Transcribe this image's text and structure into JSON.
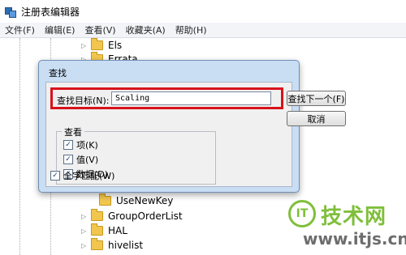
{
  "window": {
    "title": "注册表编辑器"
  },
  "menu": [
    "文件(F)",
    "编辑(E)",
    "查看(V)",
    "收藏夹(A)",
    "帮助(H)"
  ],
  "tree": {
    "items_above": [
      "Els",
      "Errata"
    ],
    "items_below": [
      "UseNewKey",
      "GroupOrderList",
      "HAL",
      "hivelist"
    ]
  },
  "find_dialog": {
    "title": "查找",
    "find_label": "查找目标(N):",
    "find_value": "Scaling",
    "find_next_button": "查找下一个(F)",
    "cancel_button": "取消",
    "look_at_title": "查看",
    "options": [
      {
        "label": "项(K)",
        "checked": true
      },
      {
        "label": "值(V)",
        "checked": true
      },
      {
        "label": "数据(D)",
        "checked": true
      }
    ],
    "whole_string": {
      "label": "全字匹配(W)",
      "checked": true
    }
  },
  "watermark": {
    "logo": "IT",
    "name": "技术网",
    "url": "www.itjs.cn"
  },
  "colors": {
    "highlight": "#d8121b",
    "dialog_frame": "#c9ddf3",
    "brand": "#7fbf3a"
  }
}
